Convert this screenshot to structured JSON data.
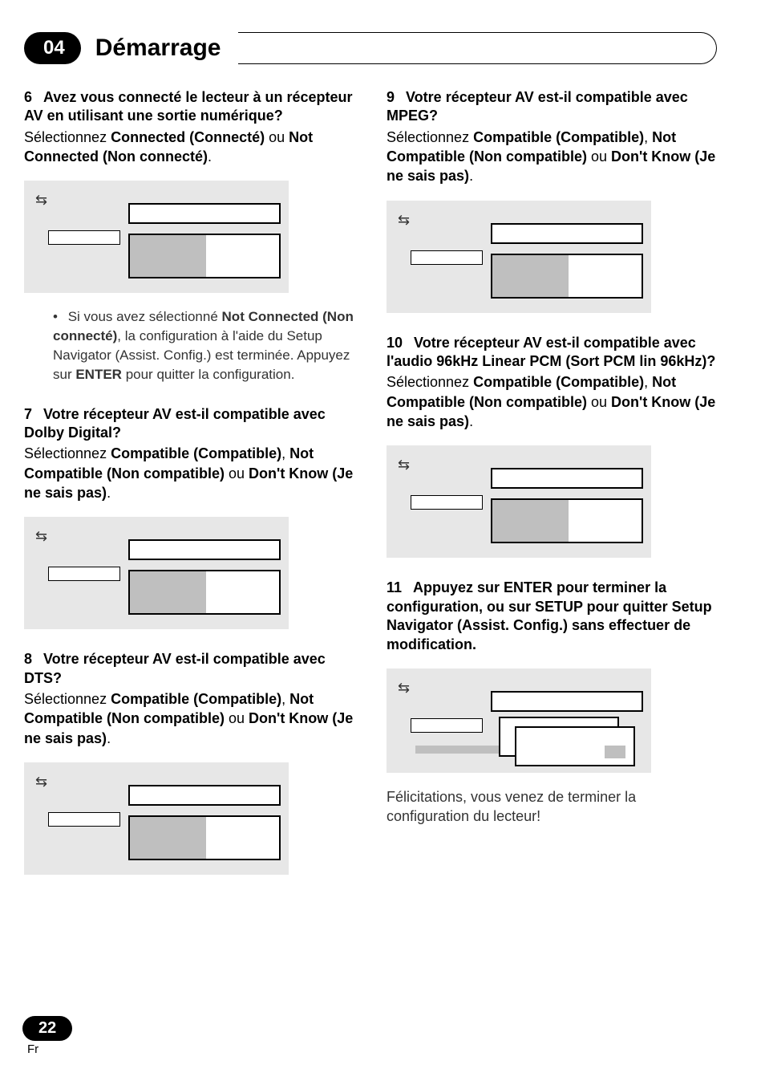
{
  "chapter_number": "04",
  "chapter_title": "Démarrage",
  "page_number": "22",
  "lang_code": "Fr",
  "left": {
    "s6": {
      "num": "6",
      "q": "Avez vous connecté le lecteur à un récepteur AV en utilisant une sortie numérique?",
      "a_pre": "Sélectionnez ",
      "a_b1": "Connected (Connecté)",
      "a_mid": " ou ",
      "a_b2": "Not Connected (Non connecté)",
      "a_end": ".",
      "bullet_pre": "Si vous avez sélectionné ",
      "bullet_b": "Not Connected (Non connecté)",
      "bullet_post1": ", la configuration à l'aide du Setup Navigator (Assist. Config.) est terminée. Appuyez sur ",
      "bullet_b2": "ENTER",
      "bullet_post2": " pour quitter la configuration."
    },
    "s7": {
      "num": "7",
      "q": "Votre récepteur AV est-il compatible avec Dolby Digital?",
      "a_pre": "Sélectionnez ",
      "a_b1": "Compatible (Compatible)",
      "a_mid1": ", ",
      "a_b2": "Not Compatible (Non compatible)",
      "a_mid2": " ou ",
      "a_b3": "Don't Know (Je ne sais pas)",
      "a_end": "."
    },
    "s8": {
      "num": "8",
      "q": "Votre récepteur AV est-il compatible avec DTS?",
      "a_pre": "Sélectionnez ",
      "a_b1": "Compatible (Compatible)",
      "a_mid1": ", ",
      "a_b2": "Not Compatible (Non compatible)",
      "a_mid2": " ou ",
      "a_b3": "Don't Know (Je ne sais pas)",
      "a_end": "."
    }
  },
  "right": {
    "s9": {
      "num": "9",
      "q": "Votre récepteur AV est-il compatible avec MPEG?",
      "a_pre": "Sélectionnez ",
      "a_b1": "Compatible (Compatible)",
      "a_mid1": ", ",
      "a_b2": "Not Compatible (Non compatible)",
      "a_mid2": " ou ",
      "a_b3": "Don't Know (Je ne sais pas)",
      "a_end": "."
    },
    "s10": {
      "num": "10",
      "q": "Votre récepteur AV est-il compatible avec l'audio 96kHz Linear PCM (Sort PCM lin 96kHz)?",
      "a_pre": "Sélectionnez ",
      "a_b1": "Compatible (Compatible)",
      "a_mid1": ", ",
      "a_b2": "Not Compatible (Non compatible)",
      "a_mid2": " ou ",
      "a_b3": "Don't Know (Je ne sais pas)",
      "a_end": "."
    },
    "s11": {
      "num": "11",
      "q": "Appuyez sur ENTER pour terminer la configuration, ou sur SETUP pour quitter Setup Navigator (Assist. Config.) sans effectuer de modification."
    },
    "closing": "Félicitations, vous venez de terminer la configuration du lecteur!"
  },
  "icon_glyph": "⇆"
}
